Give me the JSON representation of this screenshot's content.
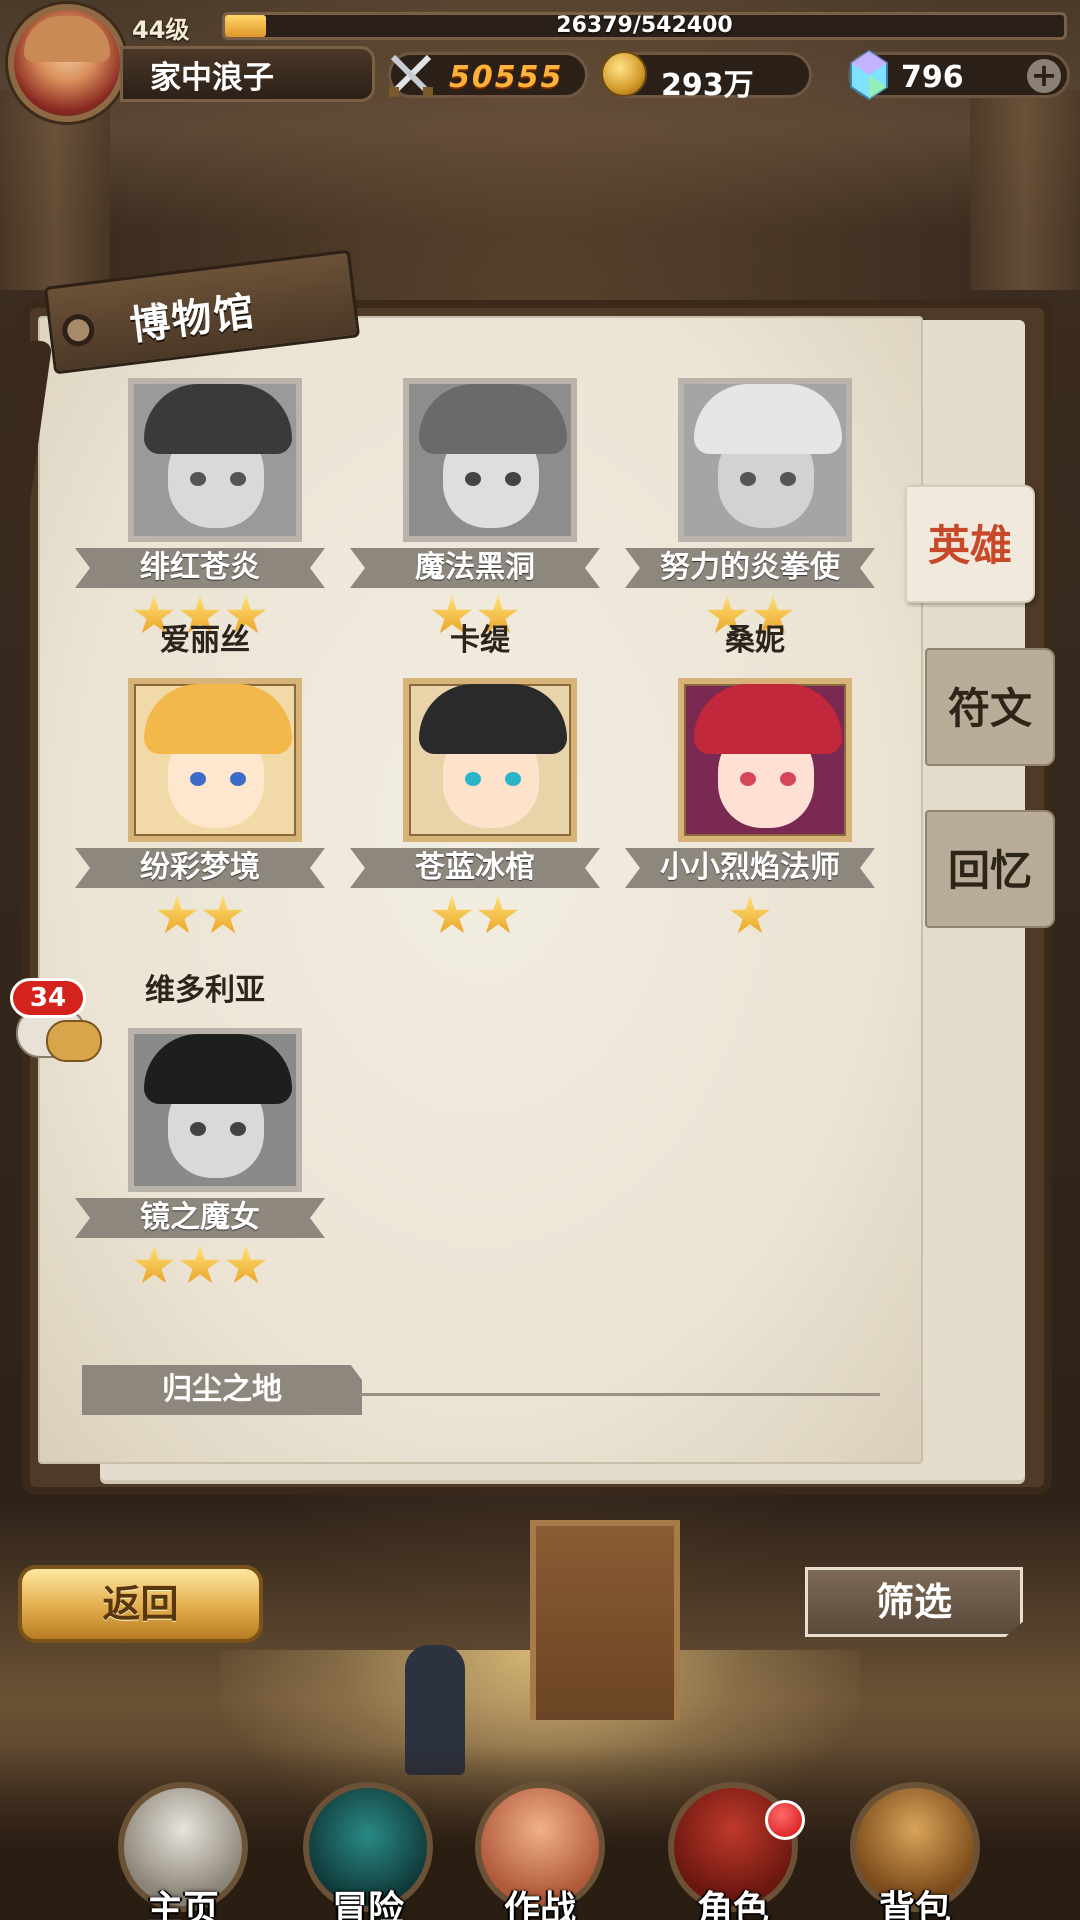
{
  "player": {
    "level": "44级",
    "xp_text": "26379/542400",
    "xp_fraction": 0.0486,
    "name": "家中浪子",
    "power": "50555",
    "gold": "293万",
    "gems": "796"
  },
  "museum": {
    "title": "博物馆",
    "tabs": [
      "英雄",
      "符文",
      "回忆"
    ],
    "active_tab": "英雄"
  },
  "heroes": [
    {
      "name": "",
      "title": "绯红苍炎",
      "stars": 3,
      "unlocked": false
    },
    {
      "name": "",
      "title": "魔法黑洞",
      "stars": 2,
      "unlocked": false
    },
    {
      "name": "",
      "title": "努力的炎拳使",
      "stars": 2,
      "unlocked": false
    },
    {
      "name": "爱丽丝",
      "title": "纷彩梦境",
      "stars": 2,
      "unlocked": true
    },
    {
      "name": "卡缇",
      "title": "苍蓝冰棺",
      "stars": 2,
      "unlocked": true
    },
    {
      "name": "桑妮",
      "title": "小小烈焰法师",
      "stars": 1,
      "unlocked": true
    },
    {
      "name": "维多利亚",
      "title": "镜之魔女",
      "stars": 3,
      "unlocked": false
    }
  ],
  "section_label": "归尘之地",
  "chat_badge": "34",
  "buttons": {
    "back": "返回",
    "filter": "筛选"
  },
  "nav": [
    "主页",
    "冒险",
    "作战",
    "角色",
    "背包"
  ],
  "colors": {
    "active_tab": "#c8492a",
    "star": "#f2b62c",
    "badge": "#d4221c"
  }
}
